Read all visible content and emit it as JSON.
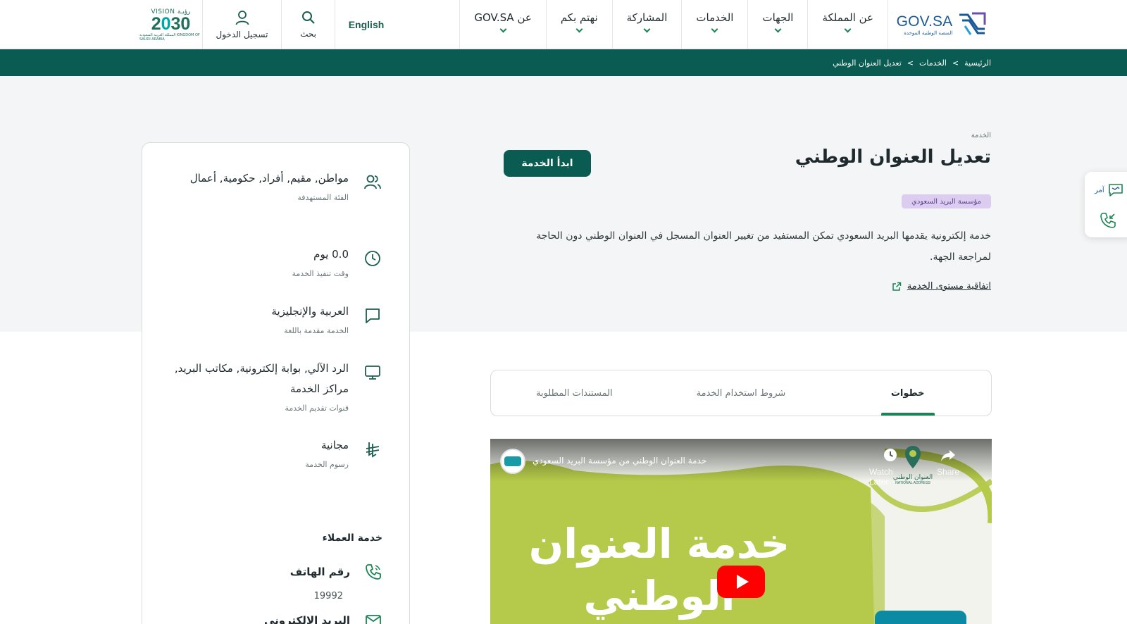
{
  "header": {
    "logo_main": "GOV.SA",
    "logo_sub": "المنصة الوطنية الموحدة",
    "nav": [
      {
        "label": "عن المملكة"
      },
      {
        "label": "الجهات"
      },
      {
        "label": "الخدمات"
      },
      {
        "label": "المشاركة"
      },
      {
        "label": "نهتم بكم"
      },
      {
        "label": "عن GOV.SA"
      }
    ],
    "language_label": "English",
    "search_label": "بحث",
    "login_label": "تسجيل الدخول",
    "vision": {
      "top": "VISION رؤيـة",
      "year_a": "2",
      "year_b": "0",
      "year_c": "30",
      "sub": "المملكة العربية السعودية KINGDOM OF SAUDI ARABIA"
    }
  },
  "breadcrumb": {
    "items": [
      "الرئيسية",
      "الخدمات",
      "تعديل العنوان الوطني"
    ],
    "separator": ">"
  },
  "service": {
    "kicker": "الخدمة",
    "title": "تعديل العنوان الوطني",
    "start_button": "ابدأ الخدمة",
    "agency": "مؤسسة البريد السعودي",
    "description": "خدمة إلكترونية يقدمها البريد السعودي تمكن المستفيد من تغيير العنوان المسجل في العنوان الوطني دون الحاجة لمراجعة الجهة.",
    "sla_link": "اتفاقية مستوى الخدمة"
  },
  "tabs": [
    {
      "label": "خطوات",
      "active": true
    },
    {
      "label": "شروط استخدام الخدمة",
      "active": false
    },
    {
      "label": "المستندات المطلوبة",
      "active": false
    }
  ],
  "video": {
    "title": "خدمة العنوان الوطني من مؤسسة البريد السعودي",
    "watch_later": "Watch Later",
    "share": "Share",
    "big_line1": "خدمة العنوان",
    "big_line2": "الوطني",
    "brand_ar": "العنوان الوطني",
    "brand_en": "NATIONAL ADDRESS"
  },
  "info_card": {
    "items": [
      {
        "icon": "users-icon",
        "value": "مواطن, مقيم, أفراد, حكومية, أعمال",
        "label": "الفئة المستهدفة"
      },
      {
        "icon": "clock-icon",
        "value": "0.0 يوم",
        "label": "وقت تنفيذ الخدمة"
      },
      {
        "icon": "speech-bubble-icon",
        "value": "العربية والإنجليزية",
        "label": "الخدمة مقدمة باللغة"
      },
      {
        "icon": "monitor-icon",
        "value": "الرد الآلي, بوابة إلكترونية, مكاتب البريد, مراكز الخدمة",
        "label": "قنوات تقديم الخدمة"
      },
      {
        "icon": "riyal-icon",
        "value": "مجانية",
        "label": "رسوم الخدمة"
      }
    ],
    "customer_service_title": "خدمة العملاء",
    "phone_label": "رقم الهاتف",
    "phone_number": "19992",
    "email_label": "البريد الإلكتروني"
  },
  "float_widget": {
    "chat_label": "آمر"
  },
  "colors": {
    "primary": "#0a5c52",
    "accent": "#1b8354",
    "logo_blue": "#1a5a96",
    "badge_bg": "#dccdf0",
    "badge_text": "#5b3e8a",
    "video_green": "#b5c94a"
  }
}
